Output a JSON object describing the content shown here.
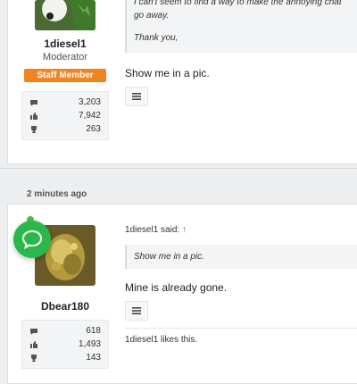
{
  "post1": {
    "quote_lines": [
      "I can't seem to find a way to make the annoying chat",
      "go away.",
      "Thank you,"
    ],
    "reply": "Show me in a pic.",
    "user": {
      "name": "1diesel1",
      "title": "Moderator",
      "badge": "Staff Member",
      "stats": [
        {
          "icon": "chat-icon",
          "value": "3,203"
        },
        {
          "icon": "thumbs-up-icon",
          "value": "7,942"
        },
        {
          "icon": "trophy-icon",
          "value": "263"
        }
      ]
    }
  },
  "post2": {
    "time": "2 minutes ago",
    "quote_author": "1diesel1 said:",
    "quote_arrow": "↑",
    "quote_text": "Show me in a pic.",
    "reply": "Mine is already gone.",
    "likes": "1diesel1 likes this.",
    "user": {
      "name": "Dbear180",
      "stats": [
        {
          "icon": "chat-icon",
          "value": "618"
        },
        {
          "icon": "thumbs-up-icon",
          "value": "1,493"
        },
        {
          "icon": "trophy-icon",
          "value": "143"
        }
      ]
    }
  },
  "colors": {
    "badge": "#f08420",
    "chat_bubble": "#2bb84a",
    "link": "#3a6fb5"
  }
}
